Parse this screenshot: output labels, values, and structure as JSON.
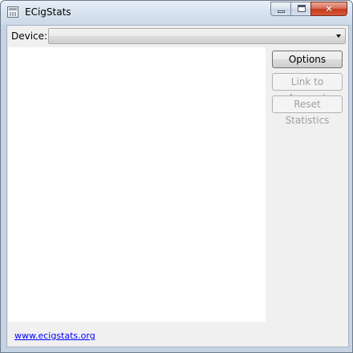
{
  "window": {
    "title": "ECigStats",
    "controls": {
      "minimize_icon": "minimize-icon",
      "maximize_icon": "maximize-icon",
      "close_icon": "close-icon",
      "close_glyph": "✕"
    }
  },
  "device": {
    "label": "Device:",
    "selected_value": ""
  },
  "actions": {
    "options_label": "Options",
    "link_account_label": "Link to Account",
    "reset_statistics_label": "Reset Statistics"
  },
  "footer": {
    "website_link": "www.ecigstats.org"
  },
  "colors": {
    "link": "#0000ff",
    "disabled_text": "#a0a0a0",
    "close_button": "#c4391c"
  }
}
